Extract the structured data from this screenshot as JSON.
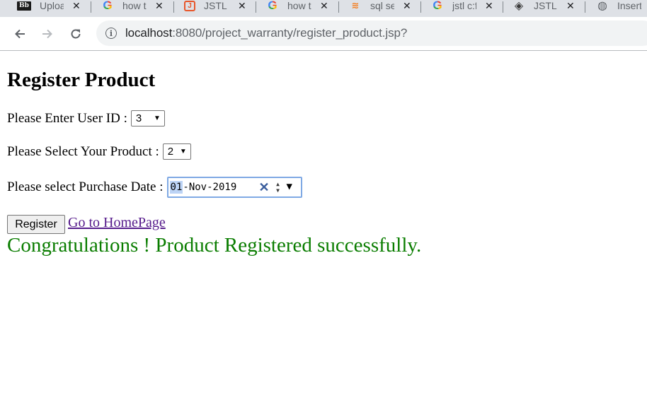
{
  "browser": {
    "tabs": [
      {
        "title": "Uploa",
        "favicon": "blackboard-icon"
      },
      {
        "title": "how t",
        "favicon": "google-icon"
      },
      {
        "title": "JSTL S",
        "favicon": "javatpoint-icon"
      },
      {
        "title": "how t",
        "favicon": "google-icon"
      },
      {
        "title": "sql se",
        "favicon": "stackoverflow-icon"
      },
      {
        "title": "jstl c:f",
        "favicon": "google-icon"
      },
      {
        "title": "JSTL -",
        "favicon": "diamond-icon"
      },
      {
        "title": "Insert",
        "favicon": "globe-icon"
      }
    ],
    "close_glyph": "✕",
    "address": {
      "host": "localhost",
      "rest": ":8080/project_warranty/register_product.jsp?"
    }
  },
  "page": {
    "title": "Register Product",
    "user_id": {
      "label": "Please Enter User ID :",
      "value": "3"
    },
    "product": {
      "label": "Please Select Your Product :",
      "value": "2"
    },
    "purchase_date": {
      "label": "Please select Purchase Date :",
      "day": "01",
      "rest": "-Nov-2019"
    },
    "register_button": "Register",
    "home_link": "Go to HomePage",
    "success_message": "Congratulations ! Product Registered successfully."
  },
  "colors": {
    "success": "#0a7d00",
    "link_visited": "#551a8b",
    "date_focus": "#7fa9e4"
  }
}
